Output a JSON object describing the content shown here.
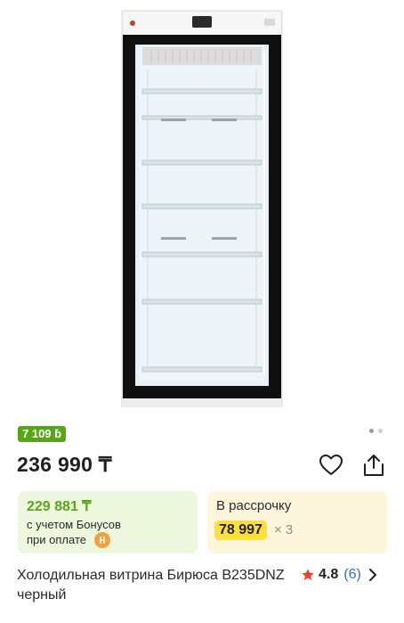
{
  "product": {
    "image_alt": "Холодильная витрина Бирюса B235DNZ черный",
    "bonus_badge": "7 109 ɓ",
    "price": "236 990 ₸",
    "title": "Холодильная витрина Бирюса B235DNZ черный",
    "rating": "4.8",
    "reviews": "(6)"
  },
  "bonus_card": {
    "price": "229 881 ₸",
    "line1": "с учетом Бонусов",
    "line2": "при оплате"
  },
  "installment_card": {
    "title": "В рассрочку",
    "amount": "78 997",
    "multiplier": "× 3"
  },
  "gallery": {
    "total_images": 2,
    "active_index": 0
  },
  "colors": {
    "bonus_green": "#58a618",
    "installment_yellow": "#ffe03a",
    "link_blue": "#2d6fd6",
    "star_red": "#e8412c"
  },
  "icons": {
    "favorite": "heart-icon",
    "share": "share-icon",
    "rating": "star-icon",
    "more": "chevron-right-icon",
    "bonus_coin": "coin-icon"
  }
}
